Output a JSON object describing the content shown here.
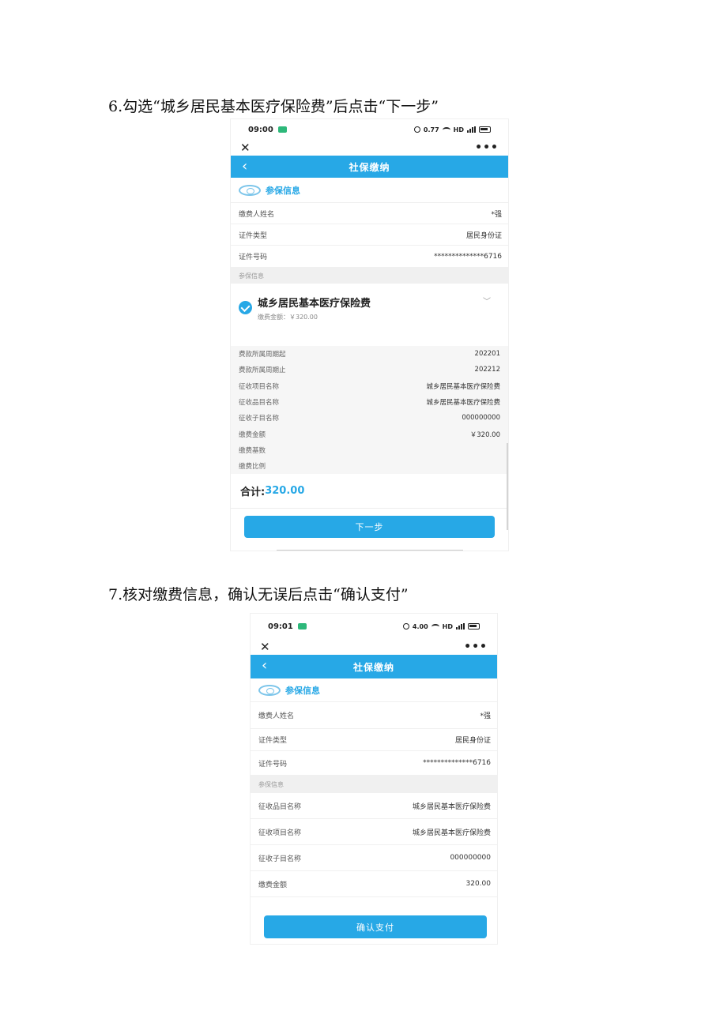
{
  "step6": {
    "caption": "6.勾选“城乡居民基本医疗保险费”后点击“下一步”",
    "status": {
      "time": "09:00",
      "speed": "0.77",
      "network": "HD"
    },
    "nav_title": "社保缴纳",
    "section_title": "参保信息",
    "person": [
      {
        "label": "缴费人姓名",
        "value": "*强"
      },
      {
        "label": "证件类型",
        "value": "居民身份证"
      },
      {
        "label": "证件号码",
        "value": "**************6716"
      }
    ],
    "band_label": "参保信息",
    "item": {
      "title": "城乡居民基本医疗保险费",
      "sub": "缴费金额：￥320.00"
    },
    "details": [
      {
        "label": "费款所属周期起",
        "value": "202201"
      },
      {
        "label": "费款所属周期止",
        "value": "202212"
      },
      {
        "label": "征收项目名称",
        "value": "城乡居民基本医疗保险费"
      },
      {
        "label": "征收品目名称",
        "value": "城乡居民基本医疗保险费"
      },
      {
        "label": "征收子目名称",
        "value": "000000000"
      },
      {
        "label": "缴费金额",
        "value": "￥320.00"
      },
      {
        "label": "缴费基数",
        "value": ""
      },
      {
        "label": "缴费比例",
        "value": ""
      }
    ],
    "total_label": "合计:",
    "total_value": "320.00",
    "next_button": "下一步"
  },
  "step7": {
    "caption": "7.核对缴费信息，确认无误后点击“确认支付”",
    "status": {
      "time": "09:01",
      "speed": "4.00",
      "network": "HD"
    },
    "nav_title": "社保缴纳",
    "section_title": "参保信息",
    "person": [
      {
        "label": "缴费人姓名",
        "value": "*强"
      },
      {
        "label": "证件类型",
        "value": "居民身份证"
      },
      {
        "label": "证件号码",
        "value": "**************6716"
      }
    ],
    "band_label": "参保信息",
    "details": [
      {
        "label": "征收品目名称",
        "value": "城乡居民基本医疗保险费"
      },
      {
        "label": "征收项目名称",
        "value": "城乡居民基本医疗保险费"
      },
      {
        "label": "征收子目名称",
        "value": "000000000"
      },
      {
        "label": "缴费金额",
        "value": "320.00"
      }
    ],
    "pay_button": "确认支付"
  },
  "icons": {
    "close": "close-icon",
    "more": "more-icon",
    "back": "back-arrow-icon",
    "check": "checked-circle-icon",
    "chevron": "chevron-down-icon"
  },
  "colors": {
    "accent": "#27a8e6"
  }
}
